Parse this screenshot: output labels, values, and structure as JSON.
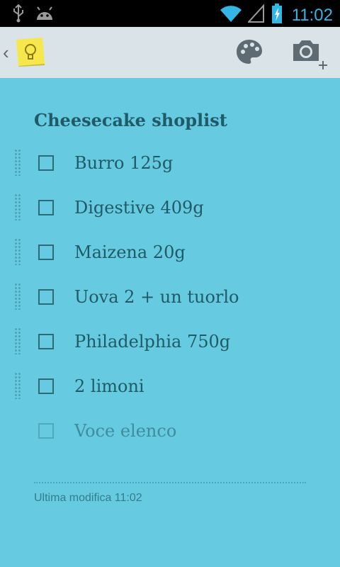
{
  "status_bar": {
    "time": "11:02",
    "icons": [
      "usb-icon",
      "android-debug-icon",
      "wifi-icon",
      "signal-icon",
      "battery-charging-icon"
    ]
  },
  "action_bar": {
    "up_caret": "‹",
    "app_icon": "keep-lightbulb-icon",
    "actions": [
      "palette-icon",
      "add-photo-icon"
    ]
  },
  "note": {
    "title": "Cheesecake shoplist",
    "items": [
      {
        "label": "Burro 125g",
        "checked": false
      },
      {
        "label": "Digestive 409g",
        "checked": false
      },
      {
        "label": "Maizena 20g",
        "checked": false
      },
      {
        "label": "Uova 2 + un tuorlo",
        "checked": false
      },
      {
        "label": "Philadelphia 750g",
        "checked": false
      },
      {
        "label": "2 limoni",
        "checked": false
      }
    ],
    "new_item_placeholder": "Voce elenco",
    "last_modified": "Ultima modifica 11:02"
  },
  "colors": {
    "note_background": "#66CBE0",
    "status_accent": "#33B5E5",
    "text": "#1F5A66"
  }
}
